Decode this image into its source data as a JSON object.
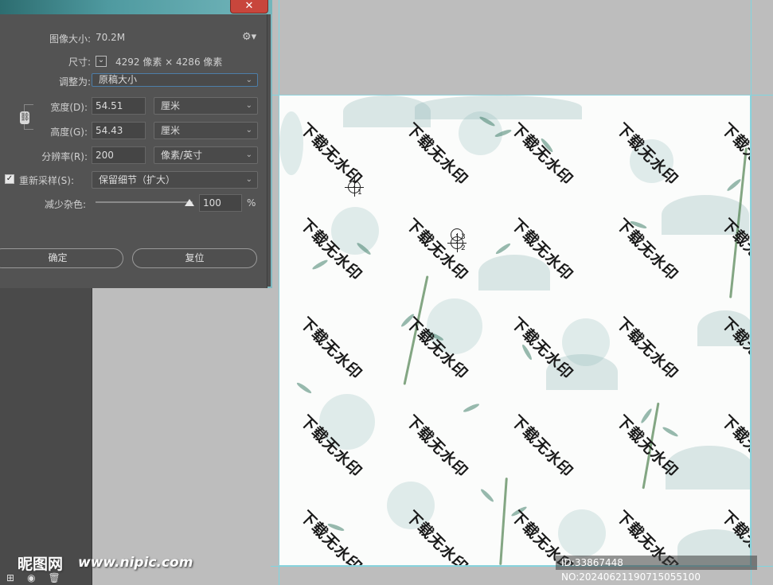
{
  "dialog": {
    "close_glyph": "✕",
    "image_size_label": "图像大小:",
    "image_size_value": "70.2M",
    "dimensions_label": "尺寸:",
    "dimensions_value": "4292 像素 × 4286 像素",
    "fit_to_label": "调整为:",
    "fit_to_value": "原稿大小",
    "width_label": "宽度(D):",
    "width_value": "54.51",
    "width_unit": "厘米",
    "height_label": "高度(G):",
    "height_value": "54.43",
    "height_unit": "厘米",
    "resolution_label": "分辨率(R):",
    "resolution_value": "200",
    "resolution_unit": "像素/英寸",
    "resample_label": "重新采样(S):",
    "resample_value": "保留细节（扩大）",
    "noise_label": "减少杂色:",
    "noise_value": "100",
    "noise_unit": "%",
    "noise_level": 1.0,
    "ok_label": "确定",
    "reset_label": "复位"
  },
  "canvas": {
    "watermark_text": "下载无水印",
    "pin_labels": [
      "1",
      "2",
      "3"
    ]
  },
  "overlay": {
    "site_logo": "昵图网",
    "site_url": "www.nipic.com",
    "image_id": "ID:33867448 NO:20240621190715055100"
  },
  "icons": {
    "gear": "gear-icon",
    "link": "link-icon",
    "close": "close-icon",
    "panel": [
      "new-layer-icon",
      "camera-icon",
      "trash-icon"
    ]
  },
  "colors": {
    "dialog_bg": "#535353",
    "guide": "#7fd6e0",
    "close": "#c8463c",
    "workspace": "#bdbdbd"
  }
}
